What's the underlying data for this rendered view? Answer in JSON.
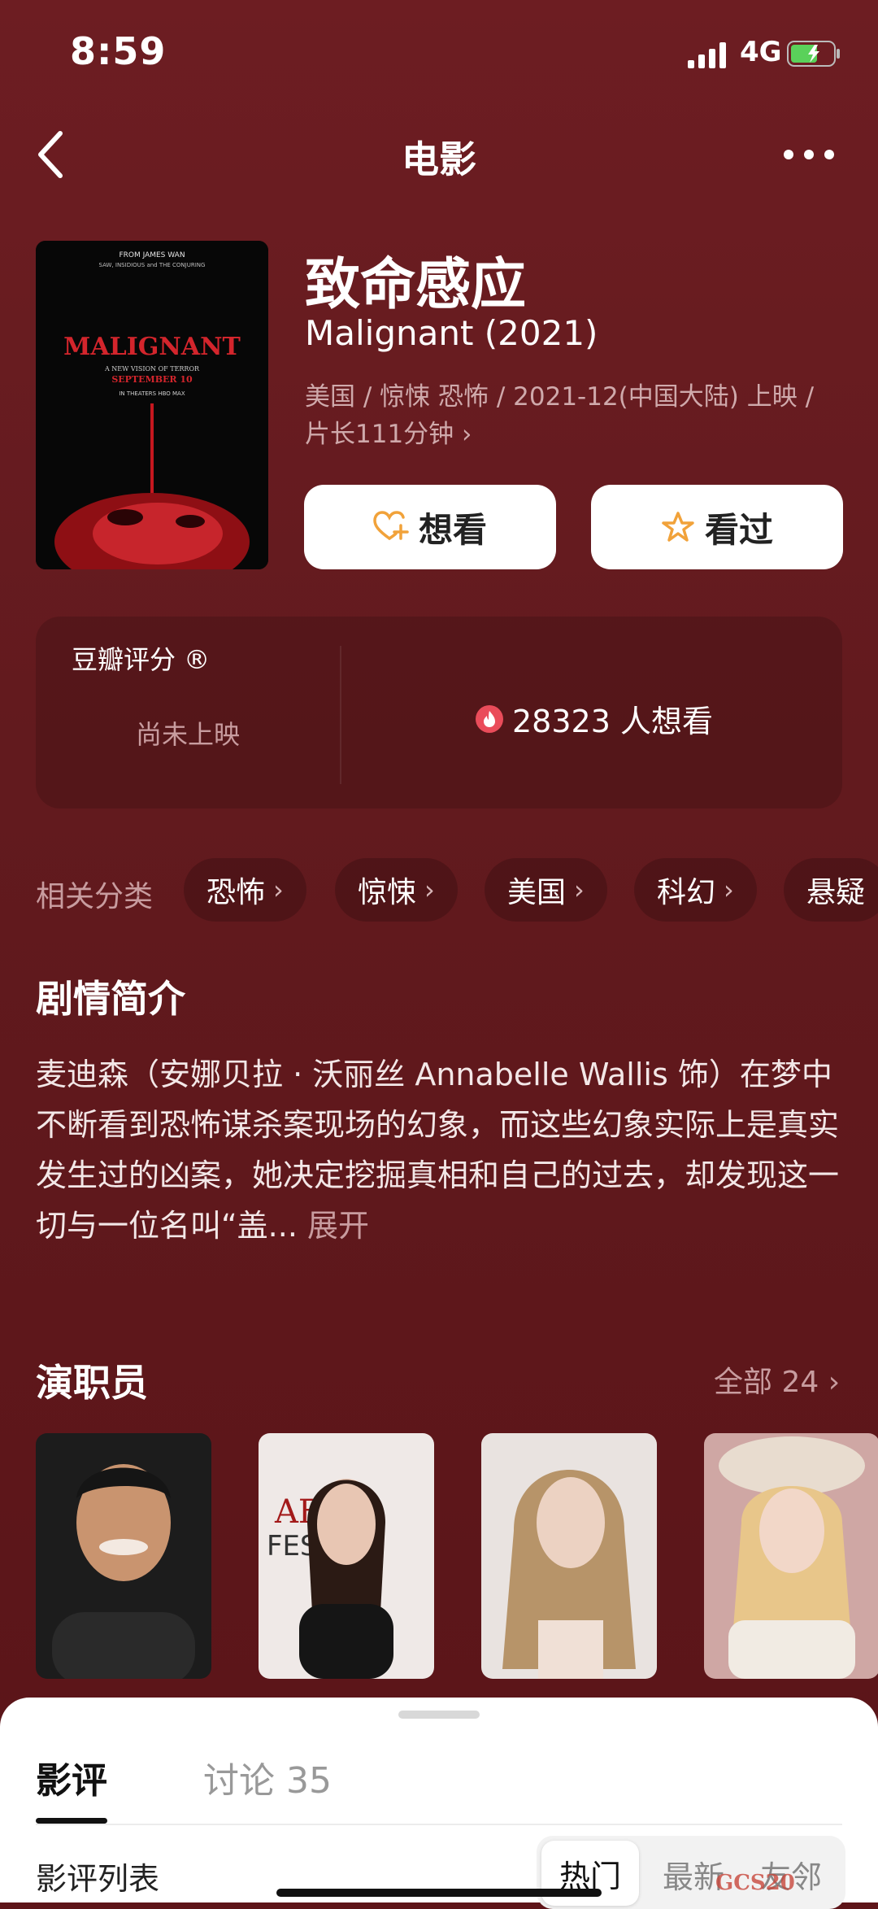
{
  "status": {
    "time": "8:59",
    "network": "4G"
  },
  "nav": {
    "title": "电影"
  },
  "movie": {
    "title": "致命感应",
    "subtitle": "Malignant (2021)",
    "meta_line1": "美国 / 惊悚 恐怖 / 2021-12(中国大陆) 上映 /",
    "meta_line2": "片长111分钟 ›",
    "want_label": "想看",
    "seen_label": "看过",
    "poster": {
      "top_credit": "FROM JAMES WAN",
      "small_line": "SAW, INSIDIOUS and THE CONJURING",
      "title": "MALIGNANT",
      "tagline": "A NEW VISION OF TERROR",
      "date": "SEPTEMBER 10",
      "release": "IN THEATERS  HBO MAX"
    }
  },
  "rating": {
    "label": "豆瓣评分 ®",
    "status": "尚未上映",
    "wish_count": "28323 人想看"
  },
  "categories": {
    "label": "相关分类",
    "items": [
      "恐怖",
      "惊悚",
      "美国",
      "科幻",
      "悬疑"
    ]
  },
  "synopsis": {
    "title": "剧情简介",
    "text": "麦迪森（安娜贝拉 · 沃丽丝 Annabelle Wallis 饰）在梦中不断看到恐怖谋杀案现场的幻象，而这些幻象实际上是真实发生过的凶案，她决定挖掘真相和自己的过去，却发现这一切与一位名叫“盖...",
    "expand": "展开"
  },
  "cast": {
    "title": "演职员",
    "all_label": "全部 24 ›",
    "people": [
      "person-1",
      "person-2",
      "person-3",
      "person-4"
    ]
  },
  "sheet": {
    "tab_reviews": "影评",
    "tab_discussion": "讨论 35",
    "list_label": "影评列表",
    "sort_hot": "热门",
    "sort_new": "最新",
    "sort_friend": "友邻"
  },
  "watermark": "GCS20"
}
